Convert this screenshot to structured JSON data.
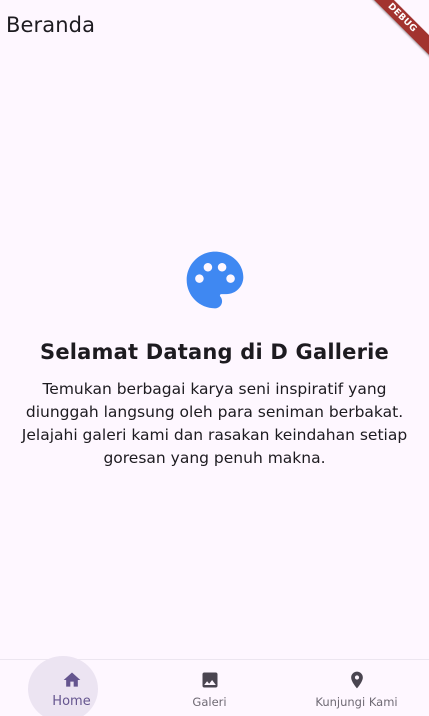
{
  "app_bar": {
    "title": "Beranda",
    "debug_banner": "DEBUG"
  },
  "main": {
    "icon": "palette-icon",
    "icon_color": "#3f88f2",
    "title": "Selamat Datang di D Gallerie",
    "description": "Temukan berbagai karya seni inspiratif yang diunggah langsung oleh para seniman berbakat. Jelajahi galeri kami dan rasakan keindahan setiap goresan yang penuh makna."
  },
  "bottom_nav": {
    "items": [
      {
        "label": "Home",
        "icon": "home-icon",
        "active": true
      },
      {
        "label": "Galeri",
        "icon": "image-icon",
        "active": false
      },
      {
        "label": "Kunjungi Kami",
        "icon": "location-pin-icon",
        "active": false
      }
    ],
    "active_color": "#65558f",
    "inactive_color": "#5f5b64"
  }
}
